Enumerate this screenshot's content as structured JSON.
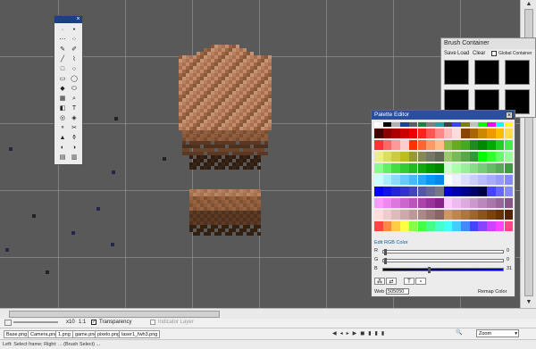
{
  "tools_window": {
    "close_label": "×"
  },
  "brush_container": {
    "title": "Brush Container",
    "menu": [
      "Save",
      "Load",
      "Clear"
    ],
    "global_label": "Global Container"
  },
  "palette_editor": {
    "title": "Palette Editor",
    "close_label": "×",
    "section_label": "Edit RGB Color",
    "channel_labels": [
      "R",
      "G",
      "B"
    ],
    "channel_values": [
      "0",
      "0",
      "31"
    ],
    "hex_label": "Web #",
    "hex_value": "505050",
    "remap_label": "Remap Color"
  },
  "zoom_bar": {
    "zoom_text": "x10",
    "ratio_text": "1:1",
    "transparency_label": "Transparency",
    "indicator_label": "Indicator Layer"
  },
  "tabs": [
    "Base.png",
    "Camera.png",
    "1.png",
    "game.png",
    "pixelo.png",
    "laser1_fwh3.png"
  ],
  "status": {
    "hint": "Left: Select frame; Right: ... (Brush Select) ...",
    "zoom_label": "Zoom"
  },
  "colors": {
    "titlebar": "#2c4f9c",
    "canvas": "#595959"
  }
}
